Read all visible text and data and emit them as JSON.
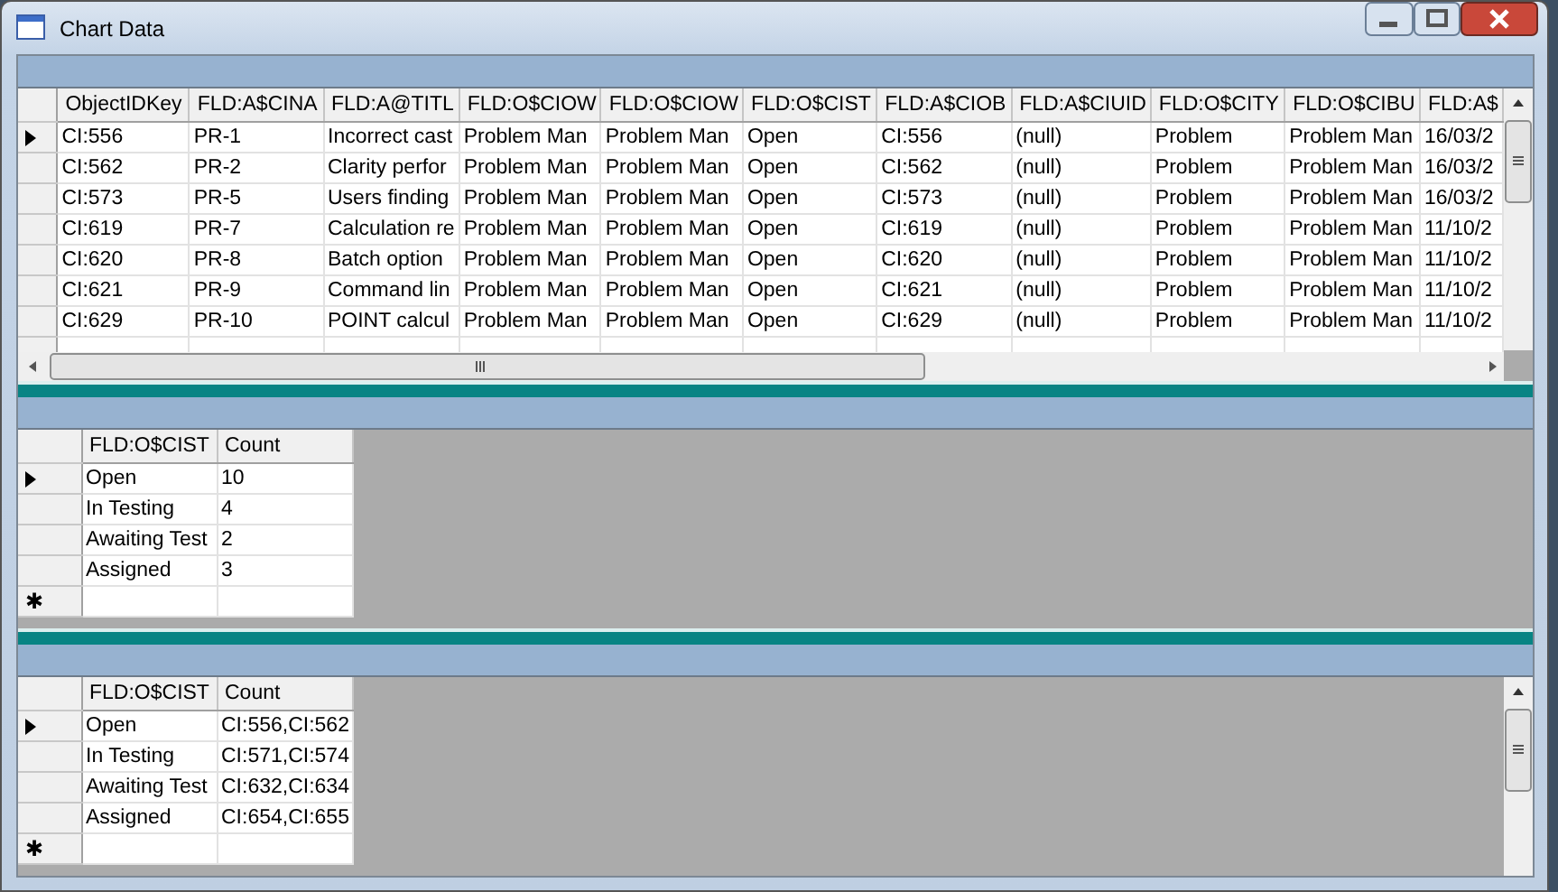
{
  "window": {
    "title": "Chart Data"
  },
  "panels": [
    {
      "columns": [
        "ObjectIDKey",
        "FLD:A$CINA",
        "FLD:A@TITL",
        "FLD:O$CIOW",
        "FLD:O$CIOW",
        "FLD:O$CIST",
        "FLD:A$CIOB",
        "FLD:A$CIUID",
        "FLD:O$CITY",
        "FLD:O$CIBU",
        "FLD:A$"
      ],
      "rows": [
        {
          "selected": true,
          "cells": [
            "CI:556",
            "PR-1",
            "Incorrect cast",
            "Problem Man",
            "Problem Man",
            "Open",
            "CI:556",
            "(null)",
            "Problem",
            "Problem Man",
            "16/03/2"
          ]
        },
        {
          "selected": false,
          "cells": [
            "CI:562",
            "PR-2",
            "Clarity perfor",
            "Problem Man",
            "Problem Man",
            "Open",
            "CI:562",
            "(null)",
            "Problem",
            "Problem Man",
            "16/03/2"
          ]
        },
        {
          "selected": false,
          "cells": [
            "CI:573",
            "PR-5",
            "Users finding",
            "Problem Man",
            "Problem Man",
            "Open",
            "CI:573",
            "(null)",
            "Problem",
            "Problem Man",
            "16/03/2"
          ]
        },
        {
          "selected": false,
          "cells": [
            "CI:619",
            "PR-7",
            "Calculation re",
            "Problem Man",
            "Problem Man",
            "Open",
            "CI:619",
            "(null)",
            "Problem",
            "Problem Man",
            "11/10/2"
          ]
        },
        {
          "selected": false,
          "cells": [
            "CI:620",
            "PR-8",
            "Batch option",
            "Problem Man",
            "Problem Man",
            "Open",
            "CI:620",
            "(null)",
            "Problem",
            "Problem Man",
            "11/10/2"
          ]
        },
        {
          "selected": false,
          "cells": [
            "CI:621",
            "PR-9",
            "Command lin",
            "Problem Man",
            "Problem Man",
            "Open",
            "CI:621",
            "(null)",
            "Problem",
            "Problem Man",
            "11/10/2"
          ]
        },
        {
          "selected": false,
          "cells": [
            "CI:629",
            "PR-10",
            "POINT calcul",
            "Problem Man",
            "Problem Man",
            "Open",
            "CI:629",
            "(null)",
            "Problem",
            "Problem Man",
            "11/10/2"
          ]
        }
      ]
    },
    {
      "columns": [
        "FLD:O$CIST",
        "Count"
      ],
      "rows": [
        {
          "selected": true,
          "cells": [
            "Open",
            "10"
          ]
        },
        {
          "selected": false,
          "cells": [
            "In Testing",
            "4"
          ]
        },
        {
          "selected": false,
          "cells": [
            "Awaiting Test",
            "2"
          ]
        },
        {
          "selected": false,
          "cells": [
            "Assigned",
            "3"
          ]
        }
      ],
      "new_row_marker": "✱"
    },
    {
      "columns": [
        "FLD:O$CIST",
        "Count"
      ],
      "rows": [
        {
          "selected": true,
          "cells": [
            "Open",
            "CI:556,CI:562"
          ]
        },
        {
          "selected": false,
          "cells": [
            "In Testing",
            "CI:571,CI:574"
          ]
        },
        {
          "selected": false,
          "cells": [
            "Awaiting Test",
            "CI:632,CI:634"
          ]
        },
        {
          "selected": false,
          "cells": [
            "Assigned",
            "CI:654,CI:655"
          ]
        }
      ],
      "new_row_marker": "✱"
    }
  ]
}
